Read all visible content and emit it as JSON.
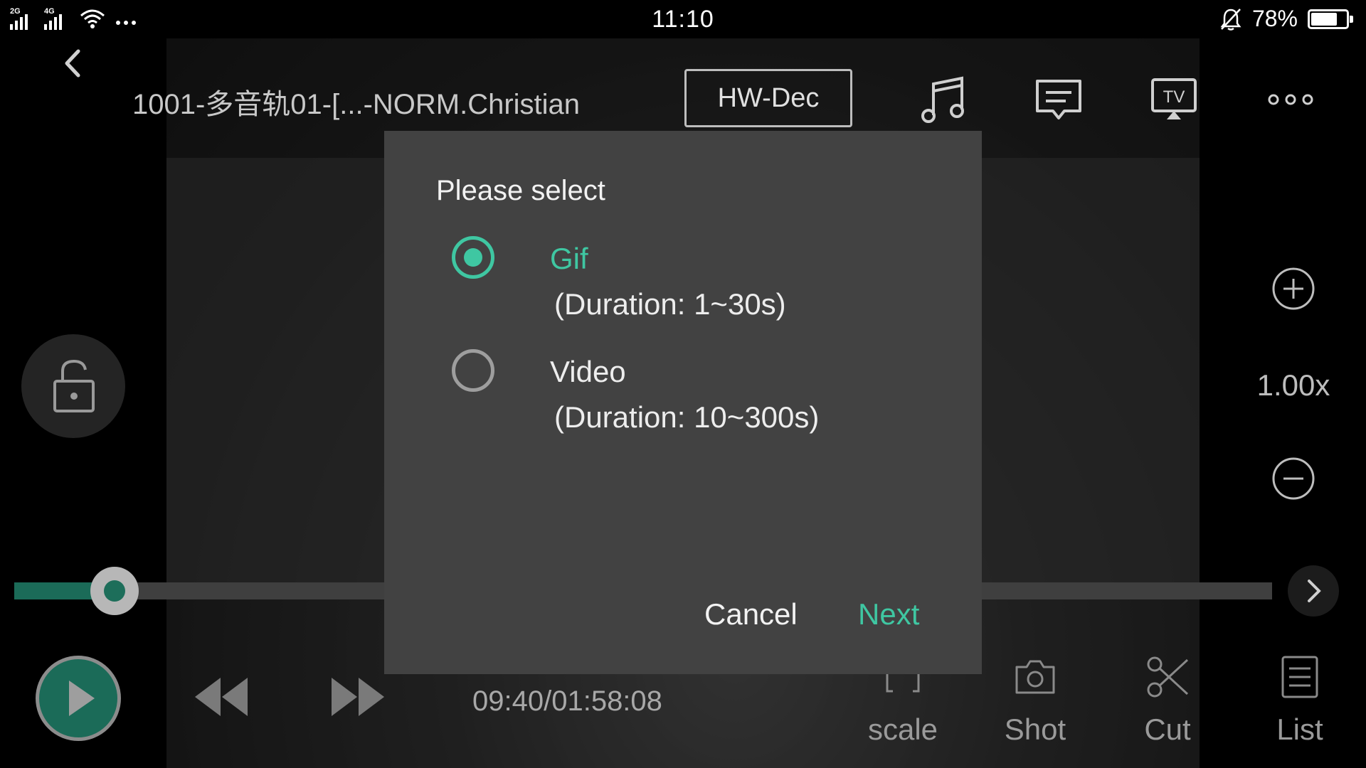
{
  "status_bar": {
    "network1": "2G",
    "network2": "4G",
    "time": "11:10",
    "battery_percent": "78%",
    "battery_level": 0.78
  },
  "toolbar": {
    "title": "1001-多音轨01-[...-NORM.Christian",
    "hwdec_label": "HW-Dec",
    "icons": [
      "back-icon",
      "music-icon",
      "subtitle-icon",
      "tv-cast-icon",
      "more-icon"
    ]
  },
  "side": {
    "speed": "1.00x"
  },
  "player": {
    "time": "09:40/01:58:08",
    "progress_fraction": 0.08,
    "tools": [
      {
        "label": "scale",
        "icon": "scale-icon"
      },
      {
        "label": "Shot",
        "icon": "camera-icon"
      },
      {
        "label": "Cut",
        "icon": "scissors-icon"
      },
      {
        "label": "List",
        "icon": "list-icon"
      }
    ]
  },
  "dialog": {
    "title": "Please select",
    "options": [
      {
        "label": "Gif",
        "duration": "(Duration:  1~30s)",
        "selected": true
      },
      {
        "label": "Video",
        "duration": "(Duration:  10~300s)",
        "selected": false
      }
    ],
    "cancel_label": "Cancel",
    "next_label": "Next"
  },
  "colors": {
    "accent": "#3fc7a2",
    "dialog_bg": "#424242",
    "play_green": "#1b6b58"
  }
}
